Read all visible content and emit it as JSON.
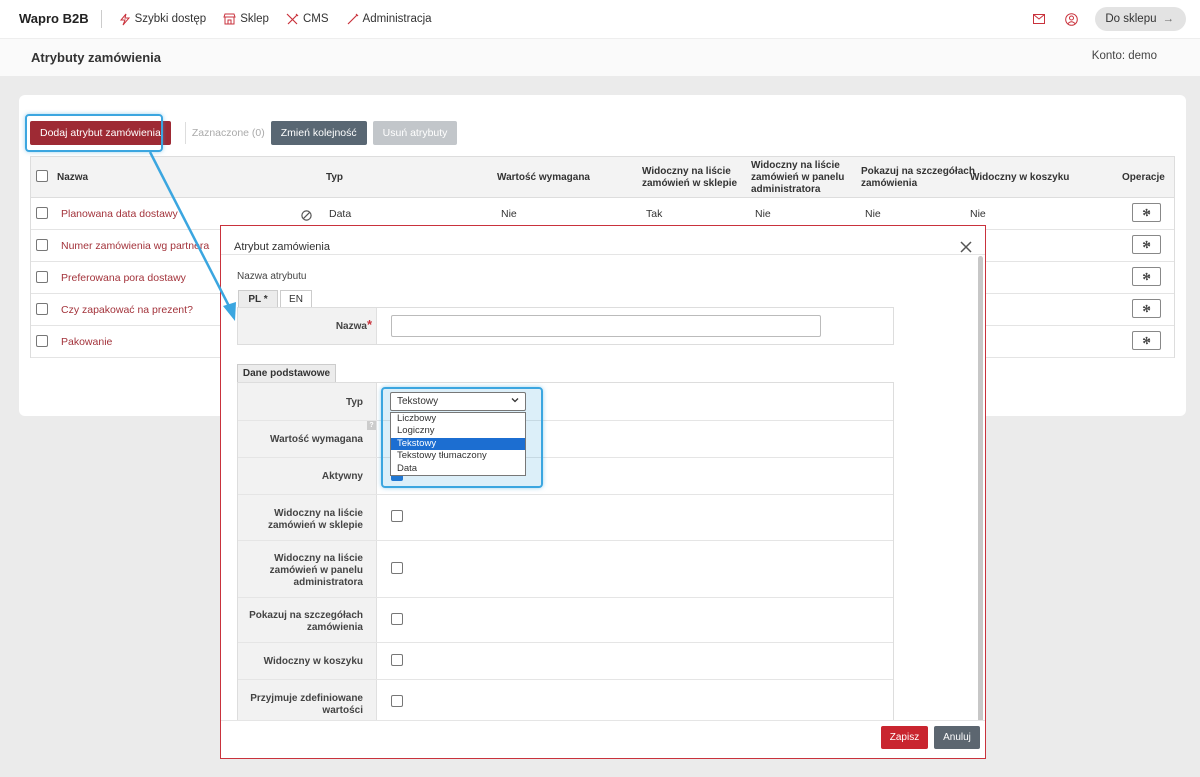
{
  "nav": {
    "brand": "Wapro B2B",
    "items": [
      {
        "label": "Szybki dostęp",
        "icon": "lightning-icon"
      },
      {
        "label": "Sklep",
        "icon": "shop-icon"
      },
      {
        "label": "CMS",
        "icon": "tools-icon"
      },
      {
        "label": "Administracja",
        "icon": "wrench-icon"
      }
    ],
    "shop_button": "Do sklepu",
    "shop_arrow": "→"
  },
  "header": {
    "title": "Atrybuty zamówienia",
    "account": "Konto: demo"
  },
  "toolbar": {
    "add_label": "Dodaj atrybut zamówienia",
    "selected_label": "Zaznaczone (0)",
    "reorder_label": "Zmień kolejność",
    "delete_label": "Usuń atrybuty"
  },
  "table": {
    "headers": {
      "name": "Nazwa",
      "type": "Typ",
      "required": "Wartość wymagana",
      "visible_shop_1": "Widoczny na liście",
      "visible_shop_2": "zamówień w sklepie",
      "visible_admin_1": "Widoczny na liście",
      "visible_admin_2": "zamówień w panelu",
      "visible_admin_3": "administratora",
      "details_1": "Pokazuj na szczegółach",
      "details_2": "zamówienia",
      "cart": "Widoczny w koszyku",
      "ops": "Operacje"
    },
    "rows": [
      {
        "name": "Planowana data dostawy",
        "type": "Data",
        "required": "Nie",
        "shop": "Tak",
        "admin": "Nie",
        "details": "Nie",
        "cart": "Nie"
      },
      {
        "name": "Numer zamówienia wg partnera"
      },
      {
        "name": "Preferowana pora dostawy"
      },
      {
        "name": "Czy zapakować na prezent?"
      },
      {
        "name": "Pakowanie"
      }
    ]
  },
  "modal": {
    "title": "Atrybut zamówienia",
    "attr_name_label": "Nazwa atrybutu",
    "tabs": [
      "PL *",
      "EN"
    ],
    "name_label": "Nazwa",
    "name_required": "*",
    "name_value": "",
    "section_tab": "Dane podstawowe",
    "type_label": "Typ",
    "type_selected": "Tekstowy",
    "type_options": [
      "Liczbowy",
      "Logiczny",
      "Tekstowy",
      "Tekstowy tłumaczony",
      "Data"
    ],
    "required_label": "Wartość wymagana",
    "help_mark": "?",
    "active_label": "Aktywny",
    "visible_shop_1": "Widoczny na liście",
    "visible_shop_2": "zamówień w sklepie",
    "visible_admin_1": "Widoczny na liście",
    "visible_admin_2": "zamówień w panelu",
    "visible_admin_3": "administratora",
    "details_1": "Pokazuj na szczegółach",
    "details_2": "zamówienia",
    "cart_label": "Widoczny w koszyku",
    "predefined_1": "Przyjmuje zdefiniowane",
    "predefined_2": "wartości",
    "save_label": "Zapisz",
    "cancel_label": "Anuluj"
  },
  "colors": {
    "accent_red": "#9e2a34",
    "highlight_blue": "#3ba6e0",
    "link_red": "#a3333b"
  }
}
